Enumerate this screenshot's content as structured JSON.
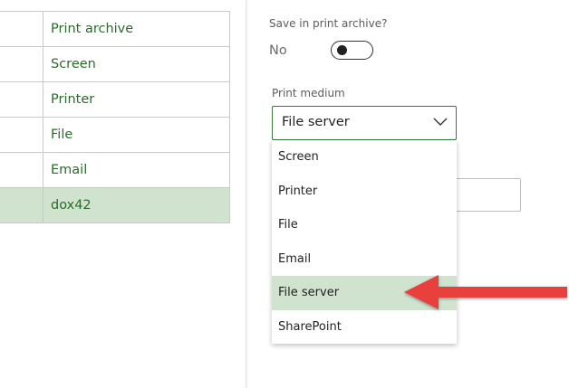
{
  "left_list": {
    "items": [
      {
        "label": "Print archive"
      },
      {
        "label": "Screen"
      },
      {
        "label": "Printer"
      },
      {
        "label": "File"
      },
      {
        "label": "Email"
      },
      {
        "label": "dox42",
        "selected": true
      }
    ]
  },
  "form": {
    "archive_label": "Save in print archive?",
    "archive_value": "No",
    "medium_label": "Print medium",
    "medium_value": "File server"
  },
  "dropdown": {
    "options": [
      {
        "label": "Screen"
      },
      {
        "label": "Printer"
      },
      {
        "label": "File"
      },
      {
        "label": "Email"
      },
      {
        "label": "File server",
        "highlighted": true
      },
      {
        "label": "SharePoint"
      }
    ]
  },
  "colors": {
    "accent_green": "#3c7a3c",
    "selection_bg": "#cfe3cf",
    "annotation_arrow": "#e8403d"
  },
  "icons": {
    "select_chevron": "chevron-down-icon",
    "annotation": "arrow-left-icon"
  }
}
